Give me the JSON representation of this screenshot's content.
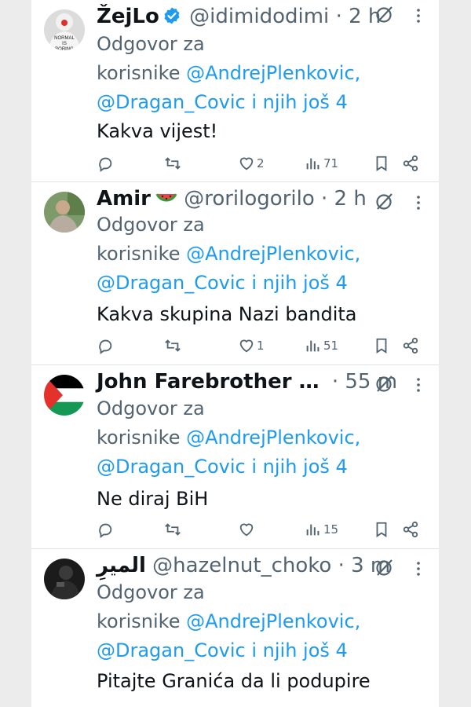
{
  "reply_prefix": "Odgovor za",
  "reply_line2_prefix": "korisnike",
  "reply_mention_1": "@AndrejPlenkovic,",
  "reply_mention_2": "@Dragan_Covic i njih još 4",
  "tweets": [
    {
      "name": "ŽejLo",
      "verified": true,
      "handle": "@idimidodimi",
      "separator": "·",
      "time": "2 h",
      "text": "Kakva vijest!",
      "likes": "2",
      "views": "71",
      "avatar": "normal-is-boring-clown-avatar"
    },
    {
      "name": "Amir",
      "emoji": "watermelon",
      "handle": "@rorilogorilo",
      "separator": "·",
      "time": "2 h",
      "text": "Kakva skupina Nazi bandita",
      "likes": "1",
      "views": "51",
      "avatar": "person-photo-avatar"
    },
    {
      "name": "John Farebrother …",
      "handle": "",
      "separator": "·",
      "time": "55 m",
      "text": "Ne diraj BiH",
      "likes": "",
      "views": "15",
      "avatar": "palestine-flag-avatar"
    },
    {
      "name": "الميرِ",
      "handle": "@hazelnut_choko",
      "separator": "·",
      "time": "3 m",
      "text": "Pitajte Granića da li podupire",
      "avatar": "dark-figure-avatar"
    }
  ],
  "colors": {
    "link": "#1d9bf0",
    "muted": "#536471",
    "text": "#0f1419",
    "divider": "#dde2e6",
    "side": "#ececec"
  },
  "icons": [
    "reply-icon",
    "retweet-icon",
    "like-icon",
    "views-icon",
    "bookmark-icon",
    "share-icon",
    "grok-icon",
    "more-icon",
    "verified-badge-icon",
    "watermelon-icon"
  ]
}
